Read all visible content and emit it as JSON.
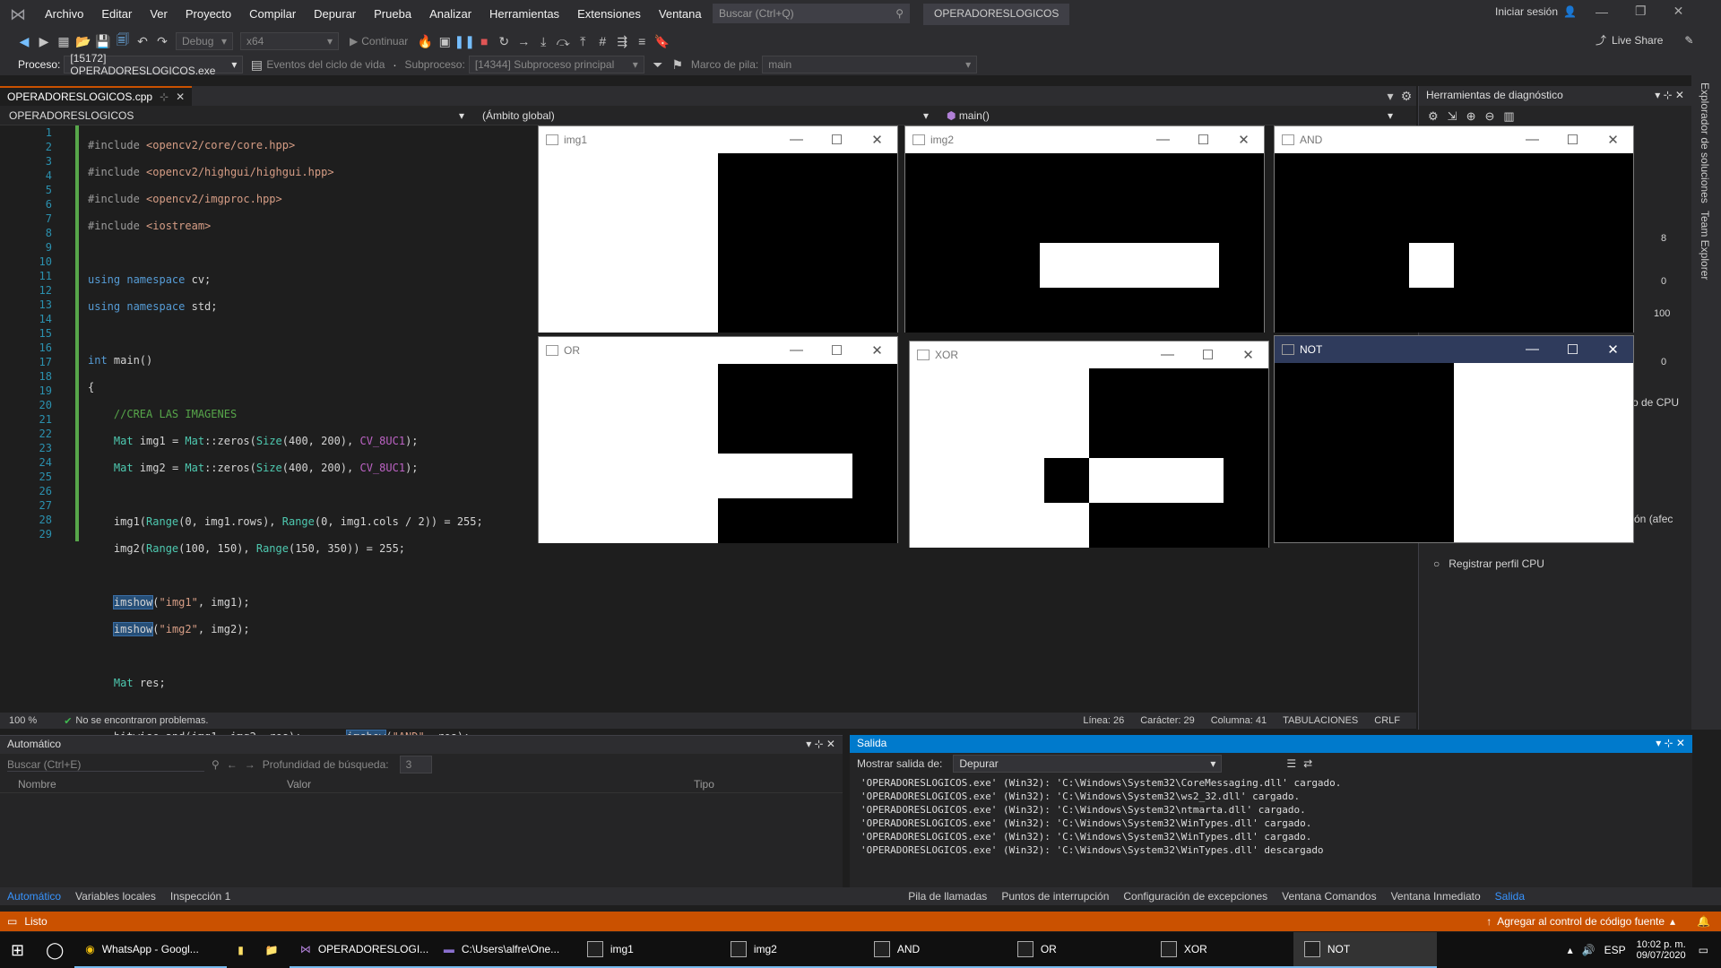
{
  "menu": {
    "items": [
      "Archivo",
      "Editar",
      "Ver",
      "Proyecto",
      "Compilar",
      "Depurar",
      "Prueba",
      "Analizar",
      "Herramientas",
      "Extensiones",
      "Ventana",
      "Ayuda"
    ],
    "search_placeholder": "Buscar (Ctrl+Q)",
    "project": "OPERADORESLOGICOS",
    "signin": "Iniciar sesión"
  },
  "toolbar": {
    "config": "Debug",
    "platform": "x64",
    "continue": "Continuar",
    "liveshare": "Live Share"
  },
  "toolbar2": {
    "process_label": "Proceso:",
    "process": "[15172] OPERADORESLOGICOS.exe",
    "events": "Eventos del ciclo de vida",
    "thread_label": "Subproceso:",
    "thread": "[14344] Subproceso principal",
    "stack_label": "Marco de pila:",
    "stack": "main"
  },
  "tab": {
    "file": "OPERADORESLOGICOS.cpp"
  },
  "nav": {
    "project": "OPERADORESLOGICOS",
    "scope": "(Ámbito global)",
    "func": "main()"
  },
  "code": {
    "lines": [
      "1",
      "2",
      "3",
      "4",
      "5",
      "6",
      "7",
      "8",
      "9",
      "10",
      "11",
      "12",
      "13",
      "14",
      "15",
      "16",
      "17",
      "18",
      "19",
      "20",
      "21",
      "22",
      "23",
      "24",
      "25",
      "26",
      "27",
      "28",
      "29"
    ]
  },
  "status_mini": {
    "zoom": "100 %",
    "problems": "No se encontraron problemas.",
    "line": "Línea: 26",
    "char": "Carácter: 29",
    "col": "Columna: 41",
    "tabs": "TABULACIONES",
    "eol": "CRLF"
  },
  "diag": {
    "title": "Herramientas de diagnóstico",
    "n8": "8",
    "n0a": "0",
    "n100": "100",
    "n0b": "0",
    "cpu": "o de CPU",
    "afec": "ntón (afec",
    "profile": "Registrar perfil CPU"
  },
  "rightstrip": {
    "a": "Explorador de soluciones",
    "b": "Team Explorer"
  },
  "windows": {
    "img1": "img1",
    "img2": "img2",
    "and": "AND",
    "or": "OR",
    "xor": "XOR",
    "not": "NOT"
  },
  "autos": {
    "title": "Automático",
    "search": "Buscar (Ctrl+E)",
    "depth": "Profundidad de búsqueda:",
    "depth_val": "3",
    "cols": [
      "Nombre",
      "Valor",
      "Tipo"
    ]
  },
  "output": {
    "title": "Salida",
    "show_label": "Mostrar salida de:",
    "show_val": "Depurar",
    "lines": [
      "'OPERADORESLOGICOS.exe' (Win32): 'C:\\Windows\\System32\\CoreMessaging.dll' cargado.",
      "'OPERADORESLOGICOS.exe' (Win32): 'C:\\Windows\\System32\\ws2_32.dll' cargado.",
      "'OPERADORESLOGICOS.exe' (Win32): 'C:\\Windows\\System32\\ntmarta.dll' cargado.",
      "'OPERADORESLOGICOS.exe' (Win32): 'C:\\Windows\\System32\\WinTypes.dll' cargado.",
      "'OPERADORESLOGICOS.exe' (Win32): 'C:\\Windows\\System32\\WinTypes.dll' cargado.",
      "'OPERADORESLOGICOS.exe' (Win32): 'C:\\Windows\\System32\\WinTypes.dll' descargado"
    ]
  },
  "bottom_tabs": {
    "left": [
      "Automático",
      "Variables locales",
      "Inspección 1"
    ],
    "right": [
      "Pila de llamadas",
      "Puntos de interrupción",
      "Configuración de excepciones",
      "Ventana Comandos",
      "Ventana Inmediato",
      "Salida"
    ]
  },
  "statusbar": {
    "ready": "Listo",
    "source": "Agregar al control de código fuente"
  },
  "taskbar": {
    "items": [
      "WhatsApp - Googl...",
      "OPERADORESLOGI...",
      "C:\\Users\\alfre\\One...",
      "img1",
      "img2",
      "AND",
      "OR",
      "XOR",
      "NOT"
    ],
    "lang": "ESP",
    "time": "10:02 p. m.",
    "date": "09/07/2020"
  }
}
